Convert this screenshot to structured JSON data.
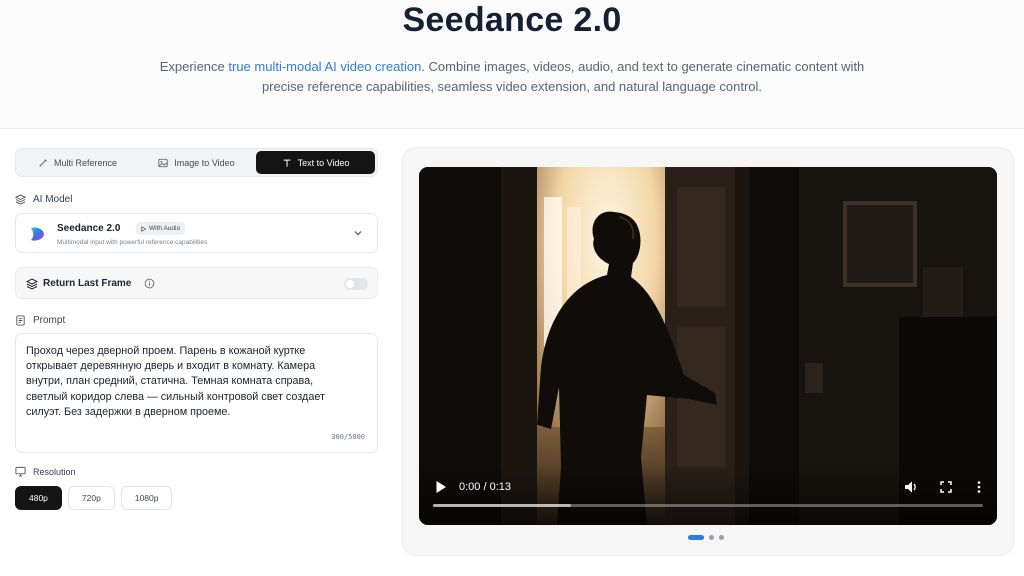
{
  "hero": {
    "title": "Seedance 2.0",
    "desc_pre": "Experience ",
    "desc_highlight": "true multi-modal AI video creation.",
    "desc_post": " Combine images, videos, audio, and text to generate cinematic content with precise reference capabilities, seamless video extension, and natural language control."
  },
  "tabs": [
    {
      "label": "Multi Reference",
      "icon": "wand-icon"
    },
    {
      "label": "Image to Video",
      "icon": "image-icon"
    },
    {
      "label": "Text to Video",
      "icon": "text-icon",
      "active": true
    }
  ],
  "ai_model": {
    "section_label": "AI Model",
    "name": "Seedance 2.0",
    "badge": "With Audio",
    "subtitle": "Multimodal input with powerful reference capabilities"
  },
  "return_last_frame": {
    "label": "Return Last Frame",
    "enabled": false
  },
  "prompt": {
    "section_label": "Prompt",
    "text": "Проход через дверной проем. Парень в кожаной куртке открывает деревянную дверь и входит в комнату. Камера внутри, план средний, статична. Темная комната справа, светлый коридор слева — сильный контровой свет создает силуэт. Без задержки в дверном проеме.",
    "counter": "300/5000"
  },
  "resolution": {
    "section_label": "Resolution",
    "options": [
      "480p",
      "720p",
      "1080p"
    ],
    "selected": "480p"
  },
  "video": {
    "time": "0:00 / 0:13",
    "buffered_fraction": 0.25
  },
  "carousel": {
    "count": 3,
    "active_index": 0
  },
  "colors": {
    "accent": "#2f7ddb",
    "active_tab": "#141414"
  }
}
